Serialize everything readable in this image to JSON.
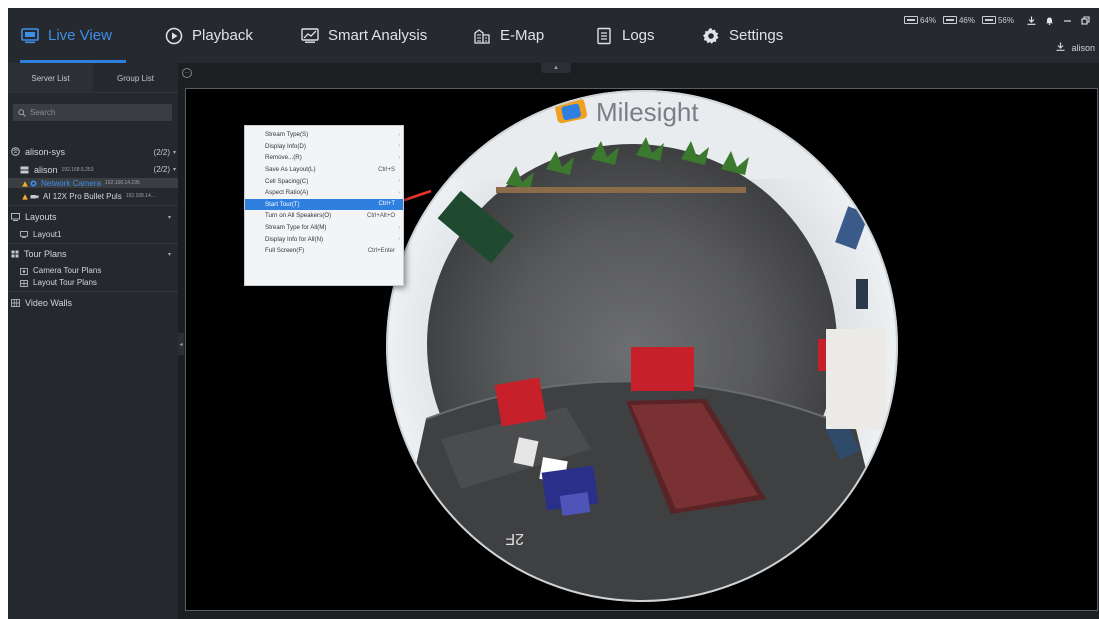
{
  "nav": {
    "tabs": [
      {
        "label": "Live View",
        "icon": "live-view-icon",
        "active": true
      },
      {
        "label": "Playback",
        "icon": "playback-icon",
        "active": false
      },
      {
        "label": "Smart Analysis",
        "icon": "smart-analysis-icon",
        "active": false
      },
      {
        "label": "E-Map",
        "icon": "e-map-icon",
        "active": false
      },
      {
        "label": "Logs",
        "icon": "logs-icon",
        "active": false
      },
      {
        "label": "Settings",
        "icon": "settings-icon",
        "active": false
      }
    ]
  },
  "status": {
    "cpu": "64%",
    "memory": "46%",
    "gpu": "56%"
  },
  "user": {
    "name": "alison"
  },
  "sidebar": {
    "tabs": [
      "Server List",
      "Group List"
    ],
    "search": {
      "placeholder": "Search",
      "value": ""
    },
    "server": {
      "name": "alison-sys",
      "count": "(2/2)"
    },
    "host": {
      "name": "alison",
      "ip": "192.168.5.253",
      "count": "(2/2)"
    },
    "cameras": [
      {
        "name": "Network Camera",
        "ip": "192.168.14.195",
        "selected": true
      },
      {
        "name": "AI 12X Pro Bullet Puls",
        "ip": "192.168.14...",
        "selected": false
      }
    ],
    "layouts": {
      "title": "Layouts",
      "items": [
        "Layout1"
      ]
    },
    "tour_plans": {
      "title": "Tour Plans",
      "items": [
        "Camera Tour Plans",
        "Layout Tour Plans"
      ]
    },
    "video_walls": {
      "title": "Video Walls"
    }
  },
  "video": {
    "brand_text": "Milesight",
    "floor_label": "2F"
  },
  "context_menu": {
    "items": [
      {
        "label": "Stream Type(S)",
        "shortcut": "",
        "submenu": true,
        "highlighted": false
      },
      {
        "label": "Display Info(D)",
        "shortcut": "",
        "submenu": true,
        "highlighted": false
      },
      {
        "label": "Remove...(R)",
        "shortcut": "",
        "submenu": true,
        "highlighted": false
      },
      {
        "label": "Save As Layout(L)",
        "shortcut": "Ctrl+S",
        "submenu": false,
        "highlighted": false
      },
      {
        "label": "Cell Spacing(C)",
        "shortcut": "",
        "submenu": true,
        "highlighted": false
      },
      {
        "label": "Aspect Ratio(A)",
        "shortcut": "",
        "submenu": true,
        "highlighted": false
      },
      {
        "label": "Start Tour(T)",
        "shortcut": "Ctrl+T",
        "submenu": false,
        "highlighted": true
      },
      {
        "label": "Turn on All Speakers(O)",
        "shortcut": "Ctrl+Alt+O",
        "submenu": false,
        "highlighted": false
      },
      {
        "label": "Stream Type for All(M)",
        "shortcut": "",
        "submenu": true,
        "highlighted": false
      },
      {
        "label": "Display Info for All(N)",
        "shortcut": "",
        "submenu": true,
        "highlighted": false
      },
      {
        "label": "Full Screen(F)",
        "shortcut": "Ctrl+Enter",
        "submenu": false,
        "highlighted": false
      }
    ]
  },
  "colors": {
    "accent": "#2f7fe0",
    "annotation_arrow": "#e8342c",
    "warning": "#f0b030"
  }
}
